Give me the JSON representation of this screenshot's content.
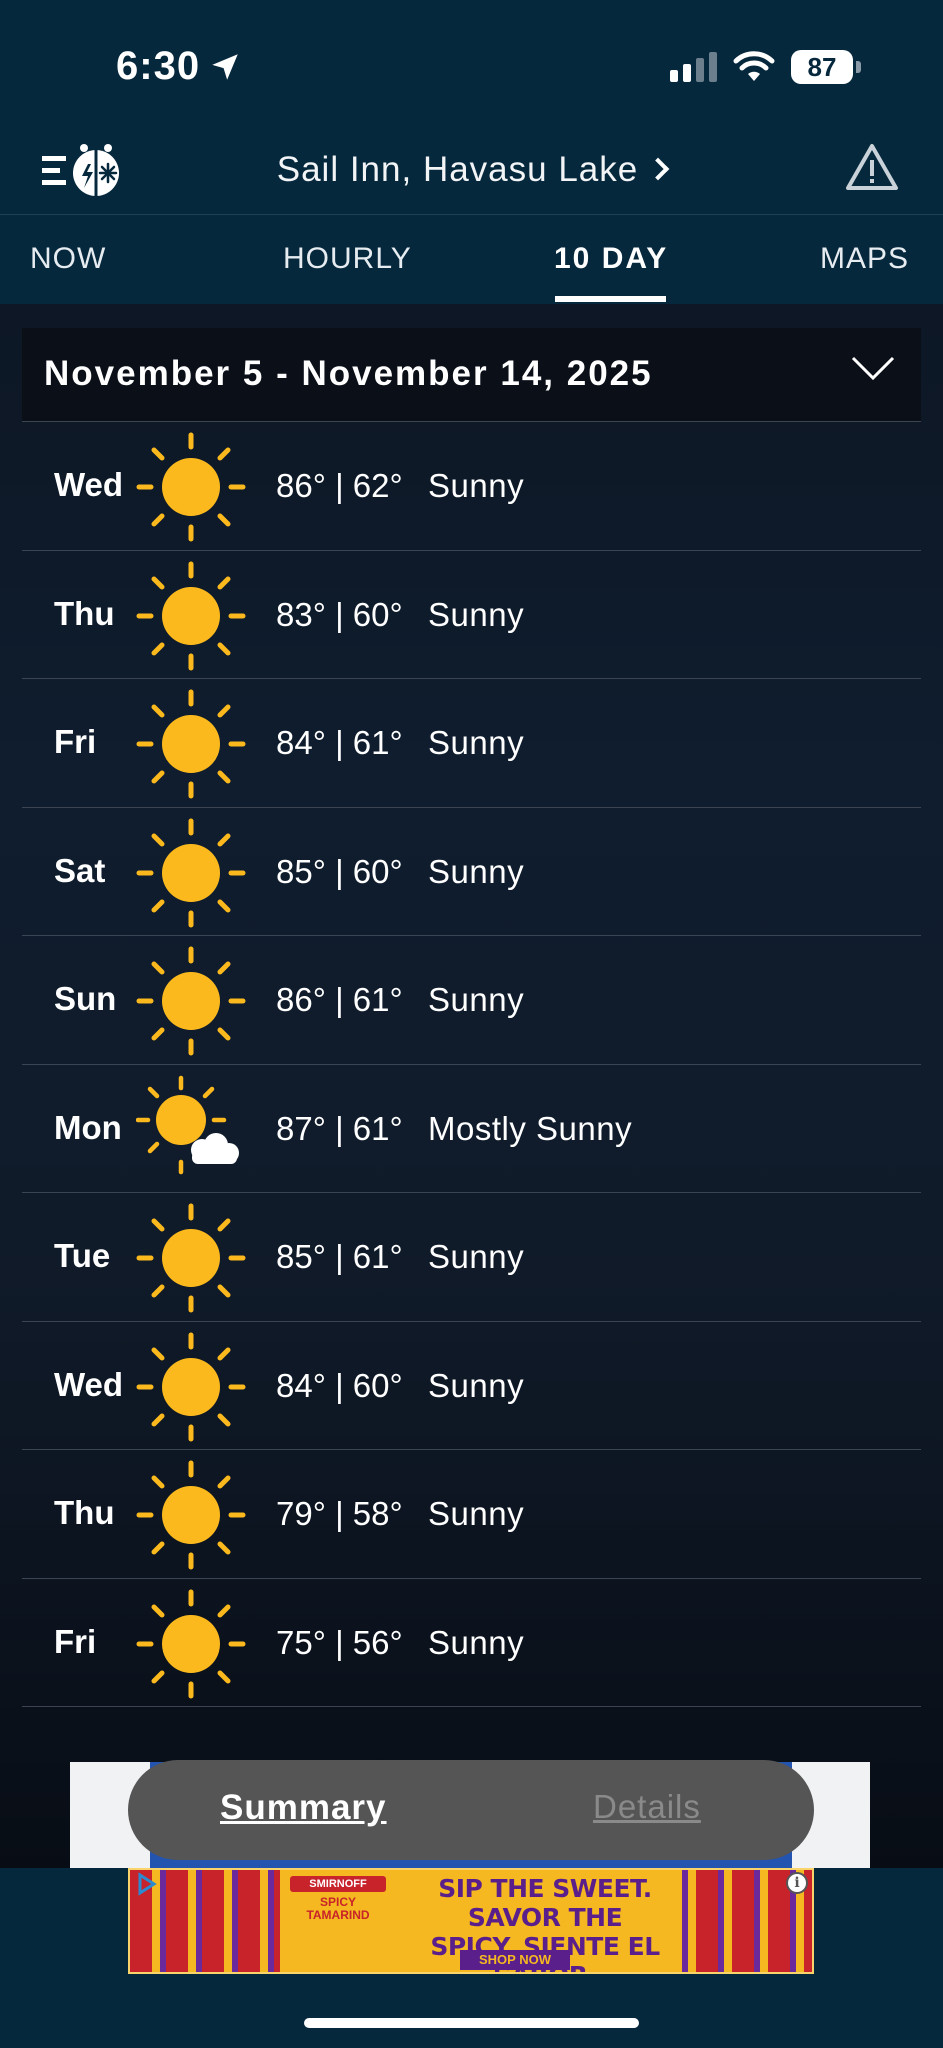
{
  "status_bar": {
    "time": "6:30",
    "battery": "87"
  },
  "header": {
    "location": "Sail Inn, Havasu Lake"
  },
  "tabs": [
    {
      "label": "NOW"
    },
    {
      "label": "HOURLY"
    },
    {
      "label": "10 DAY"
    },
    {
      "label": "MAPS"
    }
  ],
  "active_tab": "10 DAY",
  "forecast": {
    "range": "November 5 - November 14, 2025",
    "days": [
      {
        "day": "Wed",
        "temps": "86° | 62°",
        "condition": "Sunny",
        "icon": "sun-icon"
      },
      {
        "day": "Thu",
        "temps": "83° | 60°",
        "condition": "Sunny",
        "icon": "sun-icon"
      },
      {
        "day": "Fri",
        "temps": "84° | 61°",
        "condition": "Sunny",
        "icon": "sun-icon"
      },
      {
        "day": "Sat",
        "temps": "85° | 60°",
        "condition": "Sunny",
        "icon": "sun-icon"
      },
      {
        "day": "Sun",
        "temps": "86° | 61°",
        "condition": "Sunny",
        "icon": "sun-icon"
      },
      {
        "day": "Mon",
        "temps": "87° | 61°",
        "condition": "Mostly Sunny",
        "icon": "sun-cloud-icon"
      },
      {
        "day": "Tue",
        "temps": "85° | 61°",
        "condition": "Sunny",
        "icon": "sun-icon"
      },
      {
        "day": "Wed",
        "temps": "84° | 60°",
        "condition": "Sunny",
        "icon": "sun-icon"
      },
      {
        "day": "Thu",
        "temps": "79° | 58°",
        "condition": "Sunny",
        "icon": "sun-icon"
      },
      {
        "day": "Fri",
        "temps": "75° | 56°",
        "condition": "Sunny",
        "icon": "sun-icon"
      }
    ]
  },
  "toggle": {
    "summary": "Summary",
    "details": "Details"
  },
  "ad": {
    "brand": "SMIRNOFF",
    "product": "SPICY TAMARIND",
    "headline": "SIP THE SWEET. SAVOR THE SPICY. SIENTE EL SABOR.",
    "cta": "SHOP NOW"
  },
  "colors": {
    "background": "#06283d",
    "sun": "#fbb91d",
    "toggle": "#555555"
  }
}
